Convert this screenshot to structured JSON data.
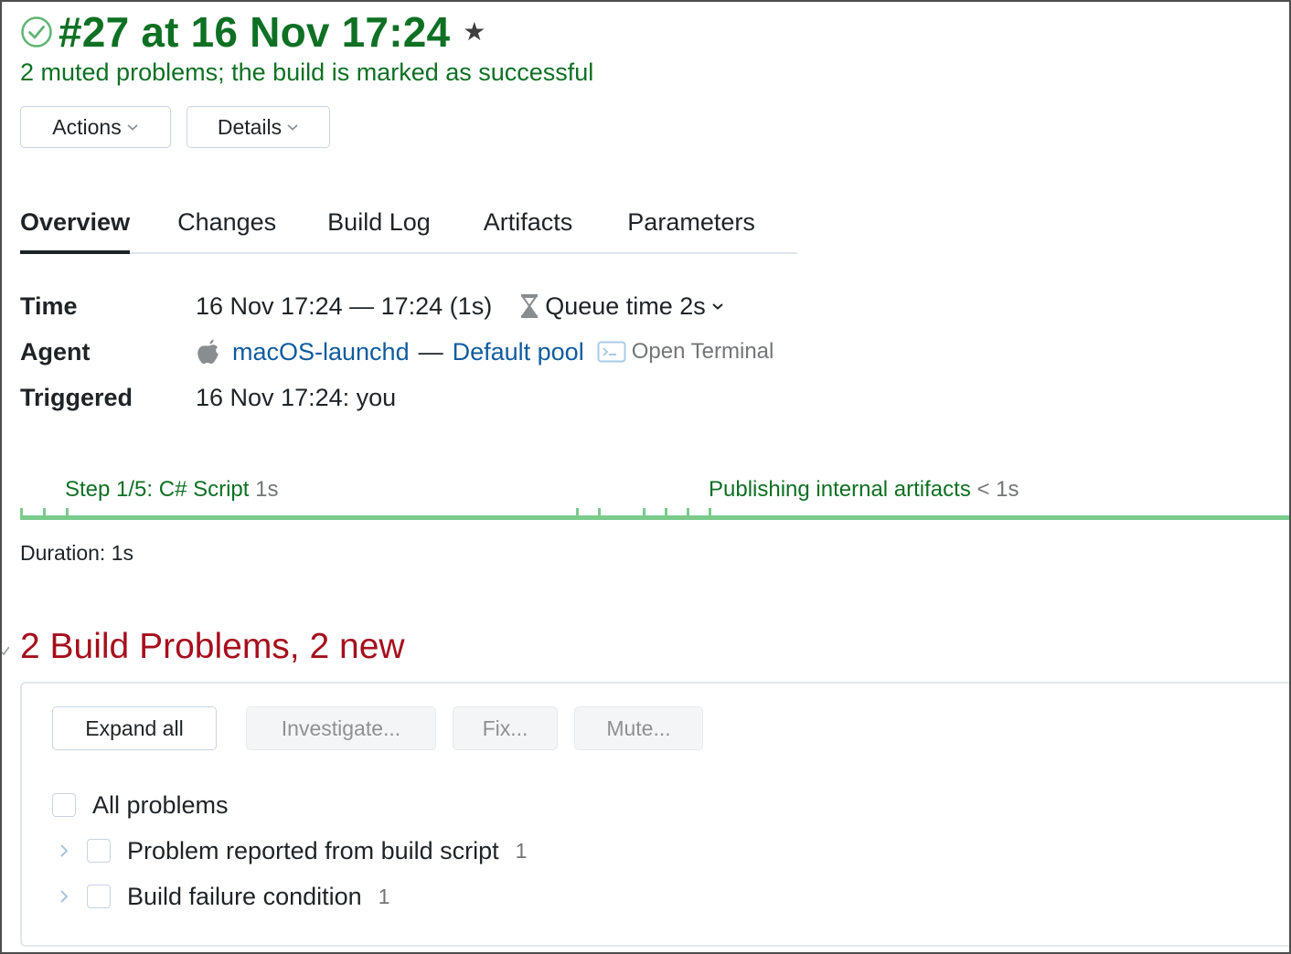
{
  "build": {
    "title": "#27 at 16 Nov 17:24",
    "status": "success",
    "status_color": "#0e7023",
    "status_icon": "check-circle-icon",
    "favorite_icon": "star-icon",
    "subtitle": "2 muted problems; the build is marked as successful"
  },
  "header_buttons": {
    "actions_label": "Actions",
    "details_label": "Details"
  },
  "tabs": [
    {
      "label": "Overview",
      "active": true
    },
    {
      "label": "Changes",
      "active": false
    },
    {
      "label": "Build Log",
      "active": false
    },
    {
      "label": "Artifacts",
      "active": false
    },
    {
      "label": "Parameters",
      "active": false
    }
  ],
  "info": {
    "time_label": "Time",
    "time_value": "16 Nov 17:24 — 17:24 (1s)",
    "queue_time": "Queue time 2s",
    "agent_label": "Agent",
    "agent_name": "macOS-launchd",
    "agent_separator": "—",
    "agent_pool": "Default pool",
    "open_terminal": "Open Terminal",
    "triggered_label": "Triggered",
    "triggered_value": "16 Nov 17:24: you"
  },
  "timeline": {
    "bar_color": "#7acb8b",
    "steps": [
      {
        "label": "Step 1/5: C# Script",
        "duration": "1s"
      },
      {
        "label": "Publishing internal artifacts",
        "duration": "< 1s"
      }
    ],
    "duration_text": "Duration: 1s"
  },
  "problems": {
    "title": "2 Build Problems, 2 new",
    "title_color": "#a60f1d",
    "buttons": {
      "expand_all": "Expand all",
      "investigate": "Investigate...",
      "fix": "Fix...",
      "mute": "Mute..."
    },
    "all_label": "All problems",
    "items": [
      {
        "label": "Problem reported from build script",
        "count": "1"
      },
      {
        "label": "Build failure condition",
        "count": "1"
      }
    ]
  }
}
